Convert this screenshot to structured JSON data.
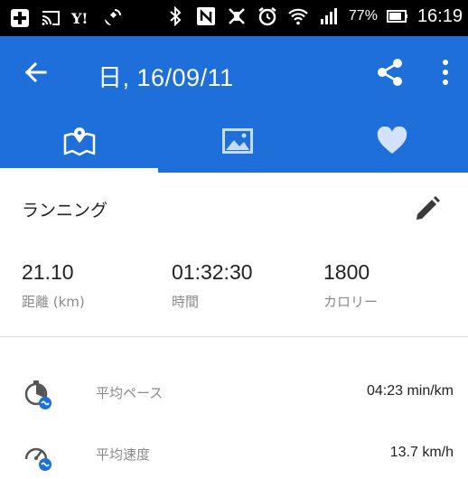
{
  "status_bar": {
    "icons": [
      "plus-square-icon",
      "cast-icon",
      "yahoo-icon",
      "satellite-icon",
      "bluetooth-icon",
      "nfc-icon",
      "vibrate-off-icon",
      "alarm-icon",
      "wifi-icon",
      "signal-icon",
      "battery-icon"
    ],
    "battery": "77%",
    "time": "16:19"
  },
  "app_bar": {
    "title": "日, 16/09/11",
    "color": "#1e6fd9"
  },
  "tabs": [
    {
      "icon": "map-icon",
      "active": true
    },
    {
      "icon": "photo-icon",
      "active": false
    },
    {
      "icon": "heart-icon",
      "active": false
    }
  ],
  "activity": {
    "type": "ランニング"
  },
  "stats": {
    "distance": {
      "value": "21.10",
      "label": "距離 (km)"
    },
    "duration": {
      "value": "01:32:30",
      "label": "時間"
    },
    "calories": {
      "value": "1800",
      "label": "カロリー"
    }
  },
  "metrics": {
    "pace": {
      "label": "平均ペース",
      "value": "04:23 min/km",
      "icon": "pace-stopwatch-icon"
    },
    "speed": {
      "label": "平均速度",
      "value": "13.7 km/h",
      "icon": "speedometer-icon"
    }
  }
}
